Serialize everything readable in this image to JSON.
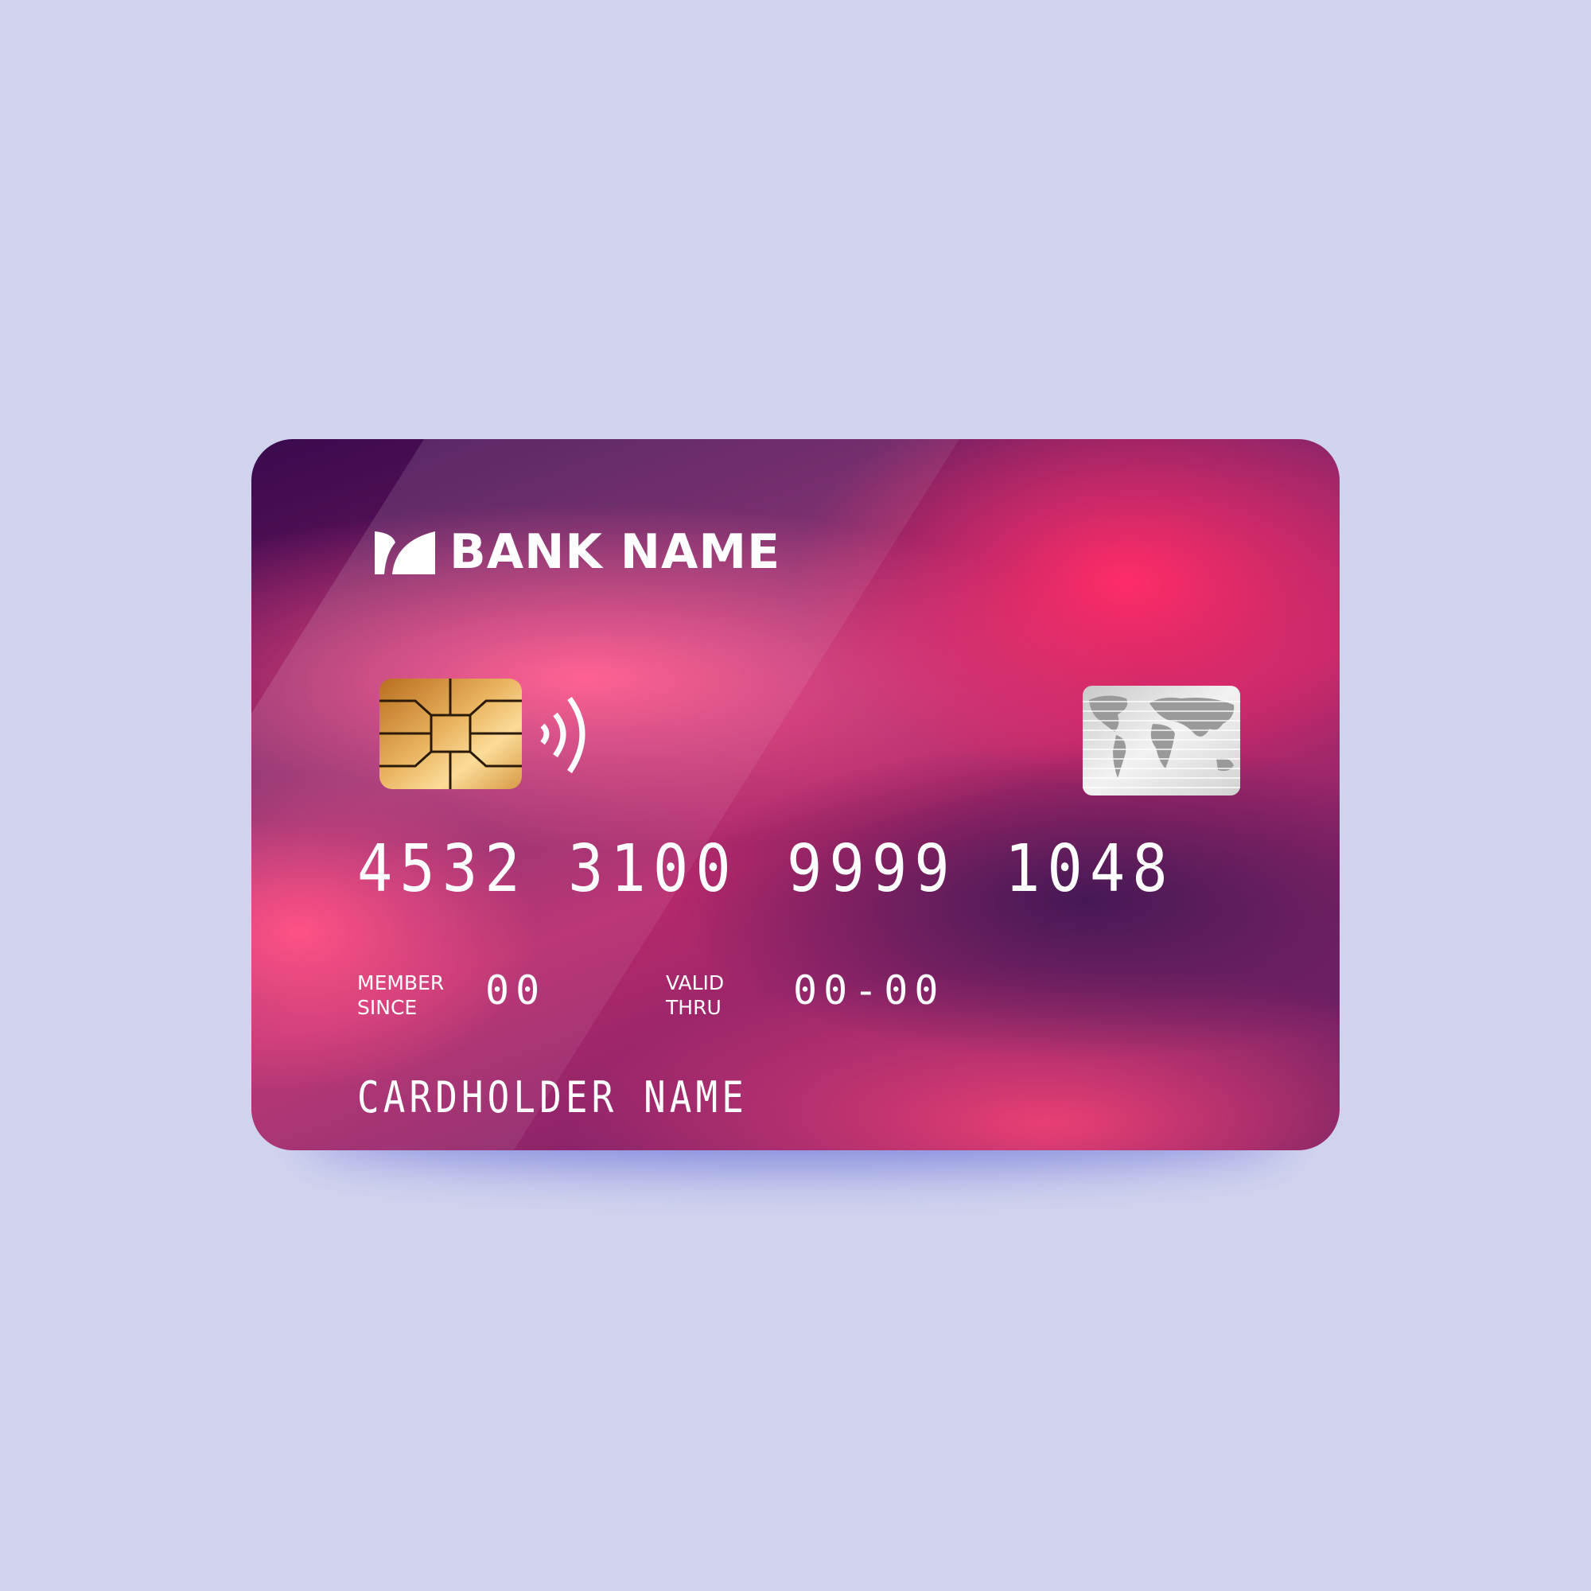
{
  "bank_name": "BANK NAME",
  "card_number": [
    "4532",
    "3100",
    "9999",
    "1048"
  ],
  "member_since": {
    "label_line1": "MEMBER",
    "label_line2": "SINCE",
    "value": "00"
  },
  "valid_thru": {
    "label_line1": "VALID",
    "label_line2": "THRU",
    "value": "00-00"
  },
  "cardholder_name": "CARDHOLDER NAME",
  "colors": {
    "background": "#d1d3ee",
    "accent": "#ff1f5e",
    "dark": "#3a0a4e"
  }
}
